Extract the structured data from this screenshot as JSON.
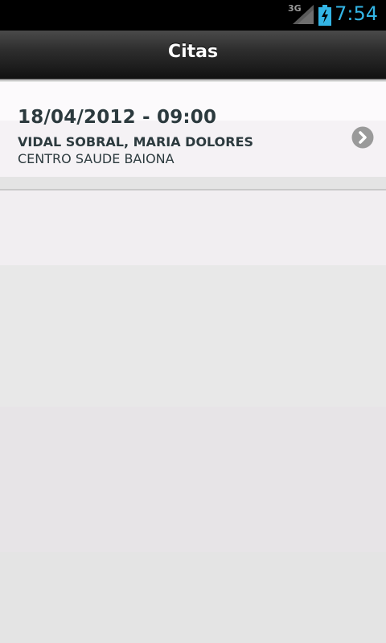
{
  "status_bar": {
    "network": "3G",
    "time": "7:54",
    "signal_icon": "cell-signal-icon",
    "battery_icon": "battery-charging-icon",
    "clock_color": "#33b5e5"
  },
  "header": {
    "title": "Citas"
  },
  "appointments": [
    {
      "datetime": "18/04/2012 - 09:00",
      "doctor": "VIDAL SOBRAL, MARIA DOLORES",
      "center": "CENTRO SAUDE BAIONA",
      "action_icon": "chevron-right-icon"
    }
  ]
}
